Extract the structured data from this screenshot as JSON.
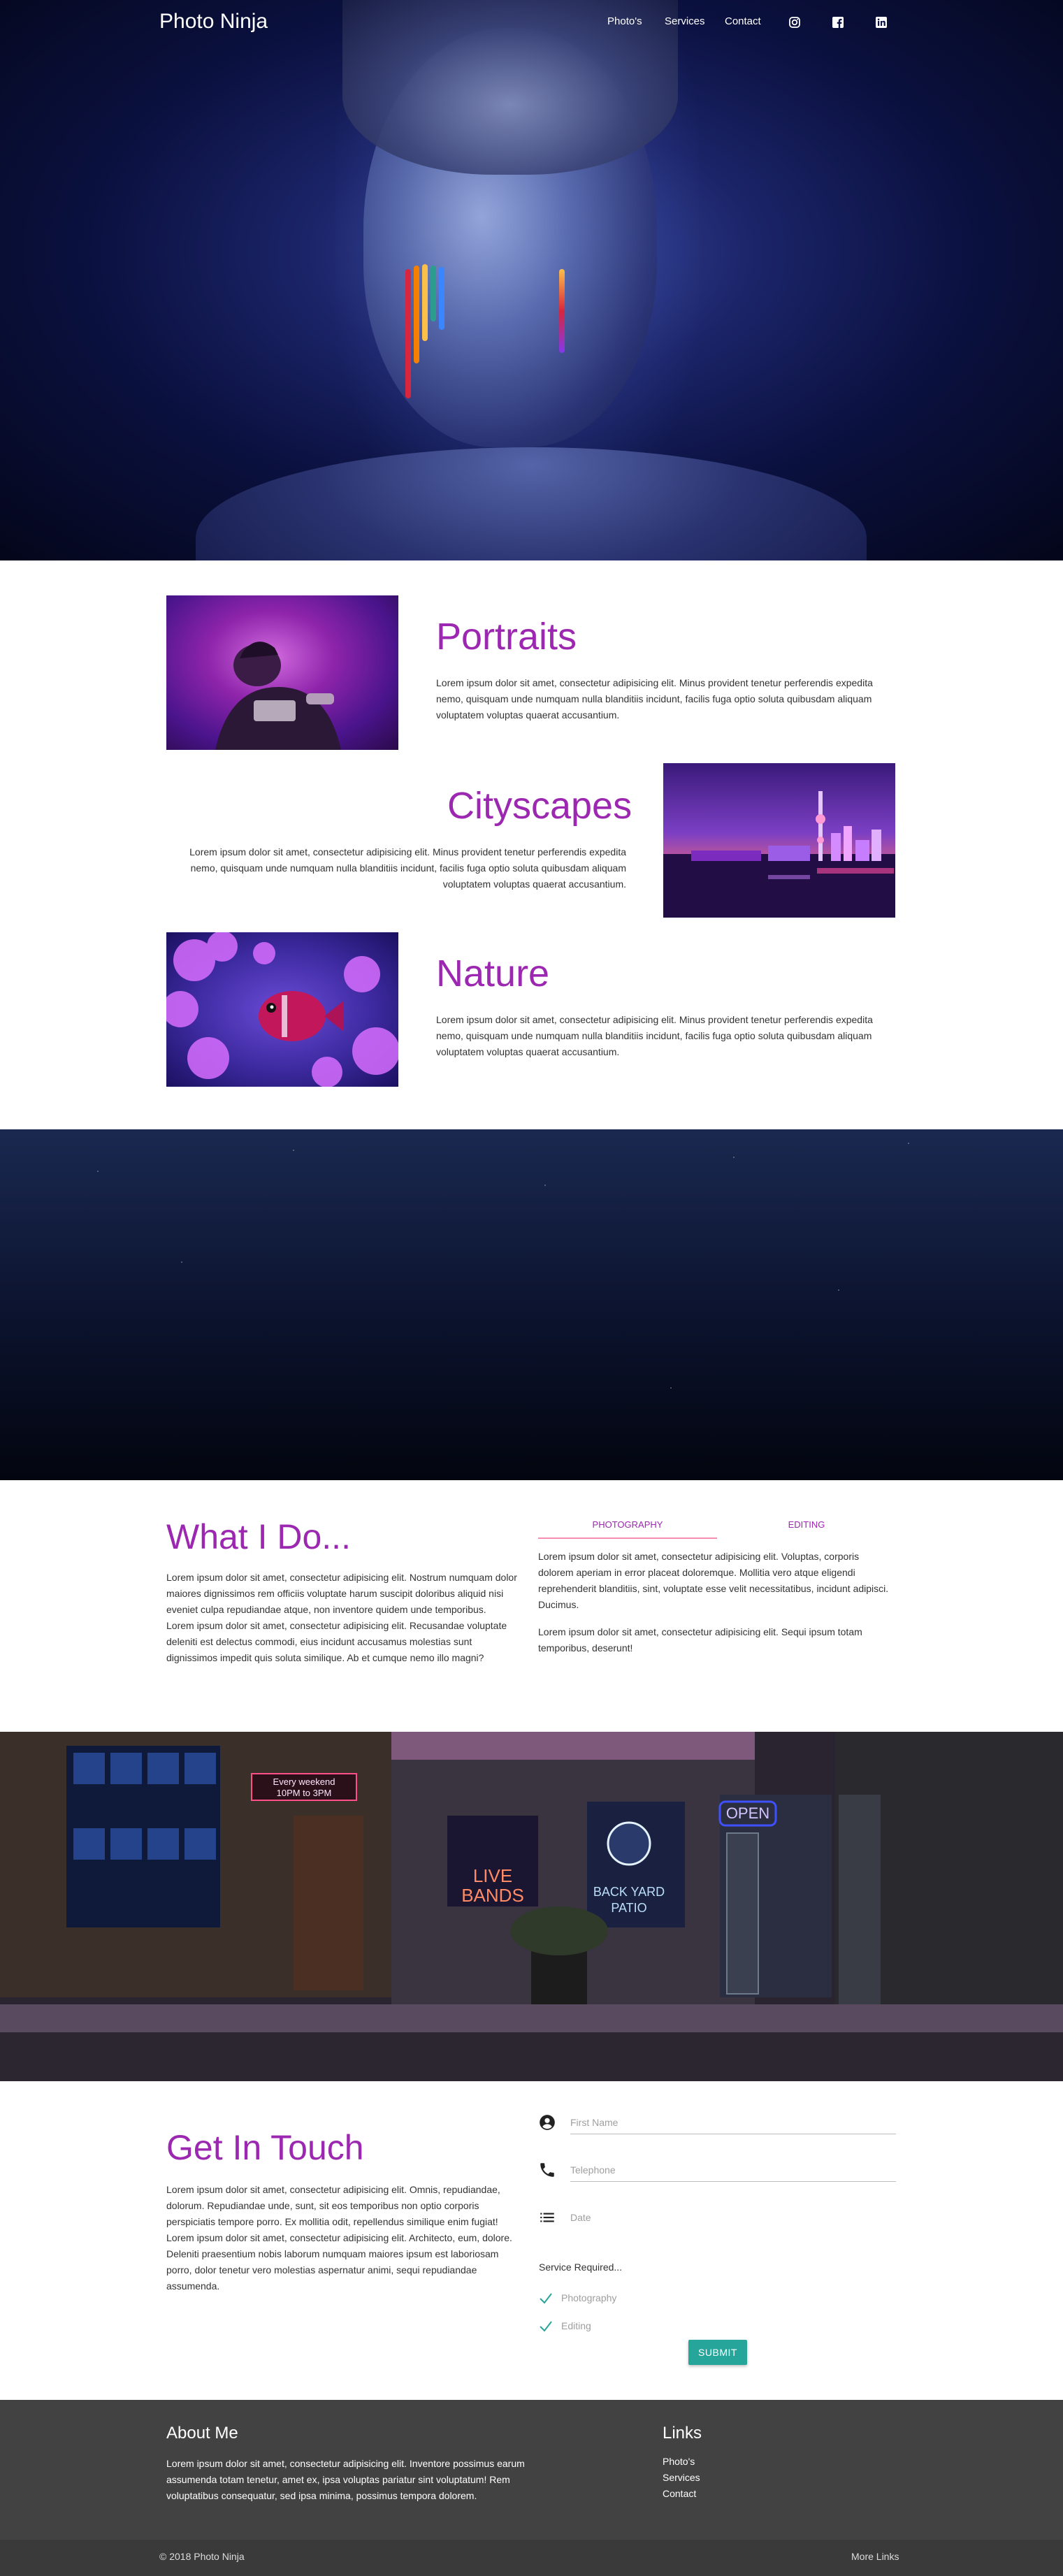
{
  "nav": {
    "brand": "Photo Ninja",
    "links": [
      "Photo's",
      "Services",
      "Contact"
    ],
    "social_icons": [
      "instagram-icon",
      "facebook-icon",
      "linkedin-icon"
    ]
  },
  "gallery": [
    {
      "title": "Portraits",
      "text": "Lorem ipsum dolor sit amet, consectetur adipisicing elit. Minus provident tenetur perferendis expedita nemo, quisquam unde numquam nulla blanditiis incidunt, facilis fuga optio soluta quibusdam aliquam voluptatem voluptas quaerat accusantium."
    },
    {
      "title": "Cityscapes",
      "text": "Lorem ipsum dolor sit amet, consectetur adipisicing elit. Minus provident tenetur perferendis expedita nemo, quisquam unde numquam nulla blanditiis incidunt, facilis fuga optio soluta quibusdam aliquam voluptatem voluptas quaerat accusantium."
    },
    {
      "title": "Nature",
      "text": "Lorem ipsum dolor sit amet, consectetur adipisicing elit. Minus provident tenetur perferendis expedita nemo, quisquam unde numquam nulla blanditiis incidunt, facilis fuga optio soluta quibusdam aliquam voluptatem voluptas quaerat accusantium."
    }
  ],
  "what_i_do": {
    "title": "What I Do...",
    "para1": "Lorem ipsum dolor sit amet, consectetur adipisicing elit. Nostrum numquam dolor maiores dignissimos rem officiis voluptate harum suscipit doloribus aliquid nisi eveniet culpa repudiandae atque, non inventore quidem unde temporibus.",
    "para2": "Lorem ipsum dolor sit amet, consectetur adipisicing elit. Recusandae voluptate deleniti est delectus commodi, eius incidunt accusamus molestias sunt dignissimos impedit quis soluta similique. Ab et cumque nemo illo magni?",
    "tabs": [
      "PHOTOGRAPHY",
      "EDITING"
    ],
    "tab_para1": "Lorem ipsum dolor sit amet, consectetur adipisicing elit. Voluptas, corporis dolorem aperiam in error placeat doloremque. Mollitia vero atque eligendi reprehenderit blanditiis, sint, voluptate esse velit necessitatibus, incidunt adipisci. Ducimus.",
    "tab_para2": "Lorem ipsum dolor sit amet, consectetur adipisicing elit. Sequi ipsum totam temporibus, deserunt!"
  },
  "street": {
    "signs": [
      "Every weekend",
      "10PM to 3PM",
      "LIVE",
      "BANDS",
      "OPEN",
      "BACK YARD",
      "PATIO"
    ]
  },
  "contact": {
    "title": "Get In Touch",
    "para1": "Lorem ipsum dolor sit amet, consectetur adipisicing elit. Omnis, repudiandae, dolorum. Repudiandae unde, sunt, sit eos temporibus non optio corporis perspiciatis tempore porro. Ex mollitia odit, repellendus similique enim fugiat!",
    "para2": "Lorem ipsum dolor sit amet, consectetur adipisicing elit. Architecto, eum, dolore. Deleniti praesentium nobis laborum numquam maiores ipsum est laboriosam porro, dolor tenetur vero molestias aspernatur animi, sequi repudiandae assumenda.",
    "first_name_placeholder": "First Name",
    "telephone_placeholder": "Telephone",
    "date_placeholder": "Date",
    "service_label": "Service Required...",
    "services": [
      "Photography",
      "Editing"
    ],
    "submit_label": "SUBMIT"
  },
  "footer": {
    "about_title": "About Me",
    "about_text": "Lorem ipsum dolor sit amet, consectetur adipisicing elit. Inventore possimus earum assumenda totam tenetur, amet ex, ipsa voluptas pariatur sint voluptatum! Rem voluptatibus consequatur, sed ipsa minima, possimus tempora dolorem.",
    "links_title": "Links",
    "links": [
      "Photo's",
      "Services",
      "Contact"
    ],
    "copyright": "© 2018 Photo Ninja",
    "more_links": "More Links"
  },
  "colors": {
    "accent": "#9c27b0",
    "tab_indicator": "#f48fb1",
    "submit": "#26a69a",
    "footer": "#424242",
    "check": "#26a69a"
  }
}
